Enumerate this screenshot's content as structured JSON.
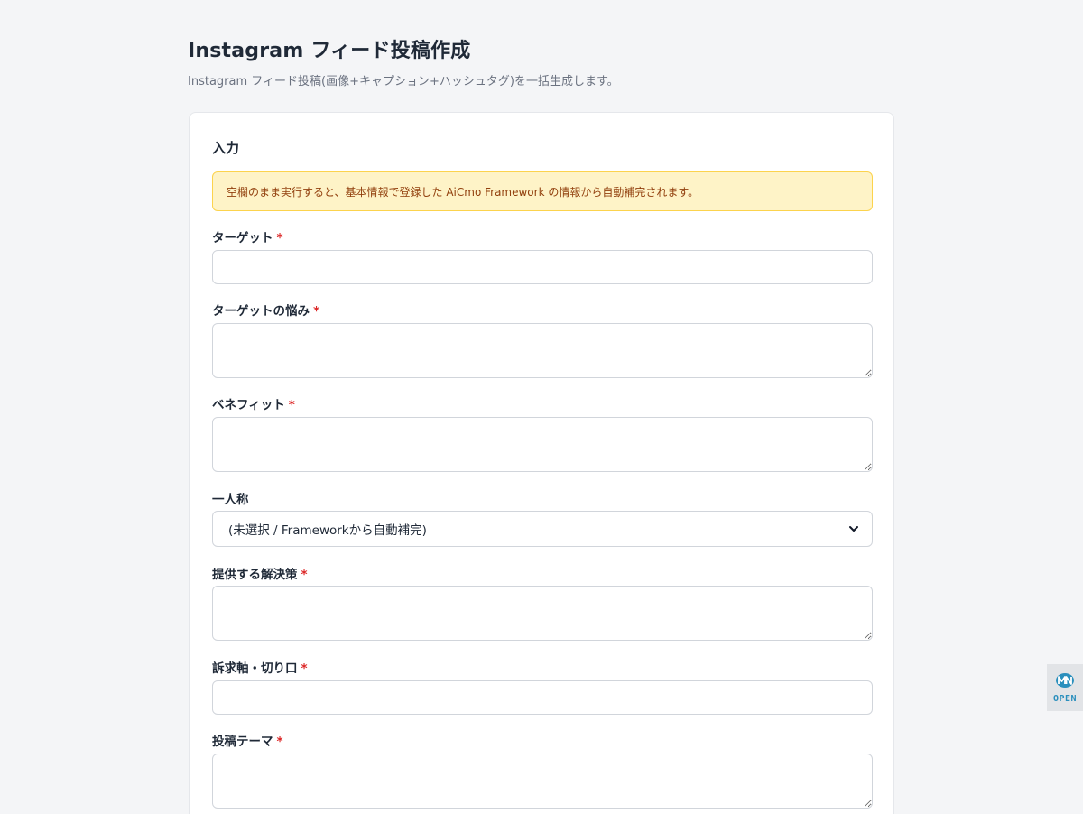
{
  "header": {
    "title": "Instagram フィード投稿作成",
    "subtitle": "Instagram フィード投稿(画像+キャプション+ハッシュタグ)を一括生成します。"
  },
  "form": {
    "section_title": "入力",
    "notice": "空欄のまま実行すると、基本情報で登録した AiCmo Framework の情報から自動補完されます。",
    "required_mark": "*",
    "fields": {
      "target": {
        "label": "ターゲット",
        "value": ""
      },
      "pain": {
        "label": "ターゲットの悩み",
        "value": ""
      },
      "benefit": {
        "label": "ベネフィット",
        "value": ""
      },
      "person": {
        "label": "一人称",
        "selected": "(未選択 / Frameworkから自動補完)"
      },
      "solution": {
        "label": "提供する解決策",
        "value": ""
      },
      "appeal": {
        "label": "訴求軸・切り口",
        "value": ""
      },
      "theme": {
        "label": "投稿テーマ",
        "value": ""
      }
    }
  },
  "widget": {
    "label": "OPEN",
    "icon": "mn-logo-icon"
  },
  "colors": {
    "required": "#dc2626",
    "notice_bg": "#fef3c7",
    "notice_text": "#92400e",
    "widget_accent": "#2a8fbd"
  }
}
